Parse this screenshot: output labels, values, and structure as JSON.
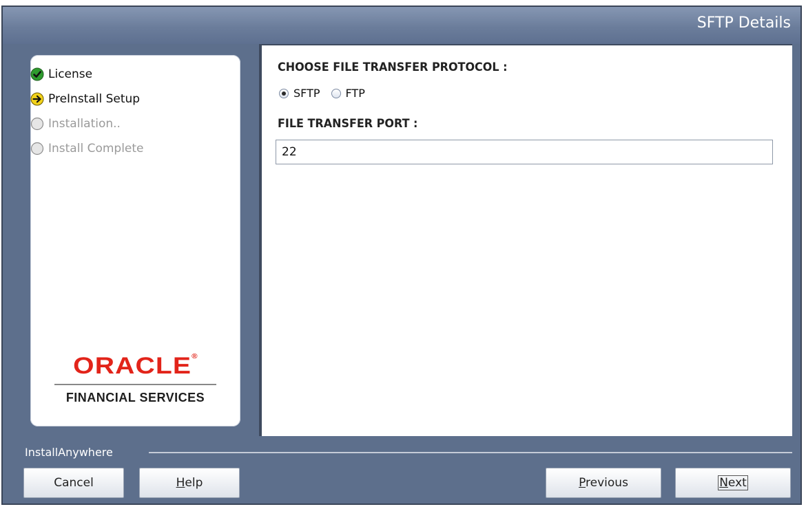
{
  "title": "SFTP Details",
  "steps": [
    {
      "label": "License",
      "status": "complete",
      "icon": "check-icon"
    },
    {
      "label": "PreInstall Setup",
      "status": "current",
      "icon": "arrow-right-icon"
    },
    {
      "label": "Installation..",
      "status": "pending",
      "icon": "empty-circle-icon"
    },
    {
      "label": "Install Complete",
      "status": "pending",
      "icon": "empty-circle-icon"
    }
  ],
  "logo": {
    "brand": "ORACLE",
    "registered_mark": "®",
    "subtitle": "FINANCIAL SERVICES",
    "brand_color": "#e2241a"
  },
  "form": {
    "protocol_heading": "CHOOSE FILE TRANSFER PROTOCOL :",
    "protocol_options": [
      {
        "label": "SFTP",
        "selected": true
      },
      {
        "label": "FTP",
        "selected": false
      }
    ],
    "port_heading": "FILE TRANSFER PORT :",
    "port_value": "22"
  },
  "footer": {
    "label": "InstallAnywhere"
  },
  "buttons": {
    "cancel": {
      "label": "Cancel",
      "mnemonic_before": "",
      "mnemonic": "",
      "mnemonic_after": "Cancel"
    },
    "help": {
      "mnemonic_before": "",
      "mnemonic": "H",
      "mnemonic_after": "elp"
    },
    "previous": {
      "mnemonic_before": "",
      "mnemonic": "P",
      "mnemonic_after": "revious"
    },
    "next": {
      "mnemonic_before": "",
      "mnemonic": "N",
      "mnemonic_after": "ext"
    }
  },
  "colors": {
    "frame": "#5d6f8c",
    "complete_icon": "#2e9b2e",
    "current_icon": "#f2d21b"
  }
}
